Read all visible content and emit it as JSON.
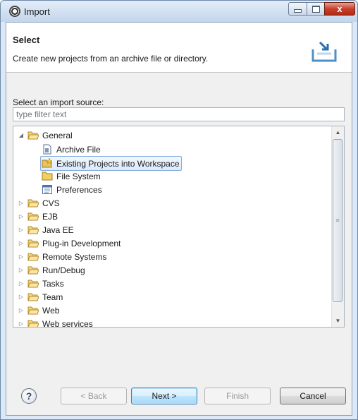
{
  "window": {
    "title": "Import"
  },
  "window_controls": {
    "close_glyph": "x"
  },
  "header": {
    "title": "Select",
    "description": "Create new projects from an archive file or directory."
  },
  "source_label": "Select an import source:",
  "filter": {
    "placeholder": "type filter text",
    "value": ""
  },
  "tree": {
    "general": {
      "label": "General",
      "expanded": true
    },
    "children": [
      {
        "label": "Archive File",
        "icon": "archive-file-icon"
      },
      {
        "label": "Existing Projects into Workspace",
        "icon": "existing-projects-icon",
        "selected": true
      },
      {
        "label": "File System",
        "icon": "folder-icon"
      },
      {
        "label": "Preferences",
        "icon": "preferences-icon"
      }
    ],
    "folders": [
      {
        "label": "CVS"
      },
      {
        "label": "EJB"
      },
      {
        "label": "Java EE"
      },
      {
        "label": "Plug-in Development"
      },
      {
        "label": "Remote Systems"
      },
      {
        "label": "Run/Debug"
      },
      {
        "label": "Tasks"
      },
      {
        "label": "Team"
      },
      {
        "label": "Web"
      },
      {
        "label": "Web services"
      }
    ]
  },
  "buttons": {
    "help": "?",
    "back": "< Back",
    "next": "Next >",
    "finish": "Finish",
    "cancel": "Cancel"
  },
  "colors": {
    "selection_border": "#84acdd",
    "folder": "#e8c25a",
    "close_button": "#c7402a"
  }
}
